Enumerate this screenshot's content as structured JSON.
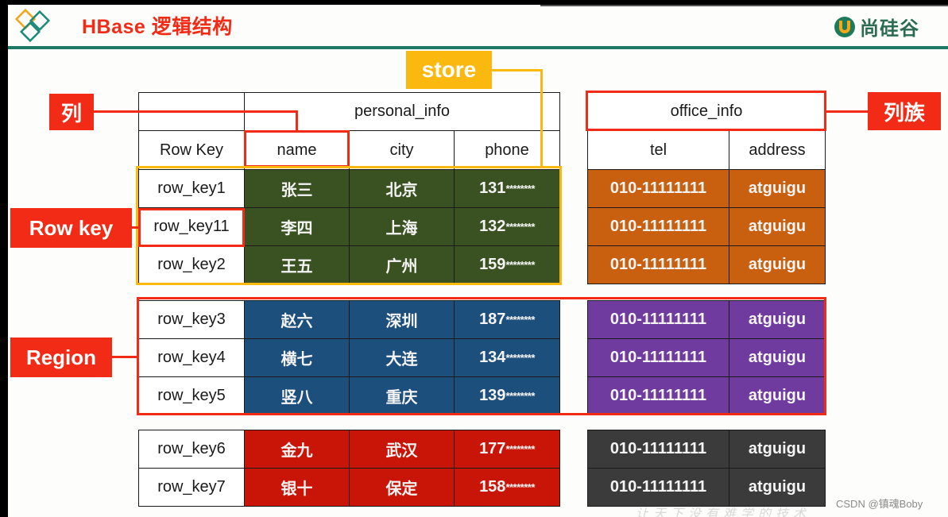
{
  "header": {
    "title": "HBase 逻辑结构",
    "brand": "尚硅谷"
  },
  "callouts": {
    "column": "列",
    "column_family": "列族",
    "store": "store",
    "row_key": "Row key",
    "region": "Region"
  },
  "table": {
    "family_personal": "personal_info",
    "family_office": "office_info",
    "col_rowkey": "Row Key",
    "col_name": "name",
    "col_city": "city",
    "col_phone": "phone",
    "col_tel": "tel",
    "col_address": "address",
    "groups": [
      {
        "personal_color": "#3a5221",
        "office_color": "#c9600f",
        "rows": [
          {
            "key": "row_key1",
            "name": "张三",
            "city": "北京",
            "phone": "131",
            "mask": "********",
            "tel": "010-11111111",
            "address": "atguigu"
          },
          {
            "key": "row_key11",
            "name": "李四",
            "city": "上海",
            "phone": "132",
            "mask": "********",
            "tel": "010-11111111",
            "address": "atguigu"
          },
          {
            "key": "row_key2",
            "name": "王五",
            "city": "广州",
            "phone": "159",
            "mask": "********",
            "tel": "010-11111111",
            "address": "atguigu"
          }
        ]
      },
      {
        "personal_color": "#1d4f7c",
        "office_color": "#6f3b9e",
        "rows": [
          {
            "key": "row_key3",
            "name": "赵六",
            "city": "深圳",
            "phone": "187",
            "mask": "********",
            "tel": "010-11111111",
            "address": "atguigu"
          },
          {
            "key": "row_key4",
            "name": "横七",
            "city": "大连",
            "phone": "134",
            "mask": "********",
            "tel": "010-11111111",
            "address": "atguigu"
          },
          {
            "key": "row_key5",
            "name": "竖八",
            "city": "重庆",
            "phone": "139",
            "mask": "********",
            "tel": "010-11111111",
            "address": "atguigu"
          }
        ]
      },
      {
        "personal_color": "#c81508",
        "office_color": "#3b3b3b",
        "rows": [
          {
            "key": "row_key6",
            "name": "金九",
            "city": "武汉",
            "phone": "177",
            "mask": "********",
            "tel": "010-11111111",
            "address": "atguigu"
          },
          {
            "key": "row_key7",
            "name": "银十",
            "city": "保定",
            "phone": "158",
            "mask": "********",
            "tel": "010-11111111",
            "address": "atguigu"
          }
        ]
      }
    ]
  },
  "watermark": "CSDN @镇魂Boby"
}
